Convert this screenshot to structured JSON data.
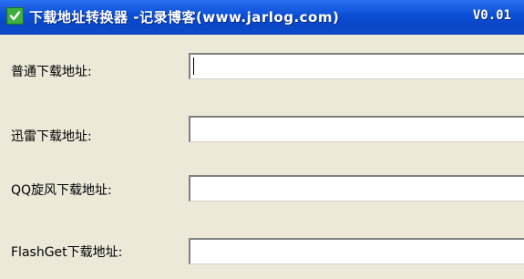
{
  "window": {
    "title": "下载地址转换器 -记录博客(www.jarlog.com)",
    "version": "V0.01",
    "icon": "checkbox-icon",
    "colors": {
      "titlebar": "#0b4fd6",
      "background": "#ece9d8",
      "icon_green": "#3fae3f"
    }
  },
  "fields": [
    {
      "label": "普通下载地址:",
      "value": ""
    },
    {
      "label": "迅雷下载地址:",
      "value": ""
    },
    {
      "label": "QQ旋风下载地址:",
      "value": ""
    },
    {
      "label": "FlashGet下载地址:",
      "value": ""
    }
  ]
}
